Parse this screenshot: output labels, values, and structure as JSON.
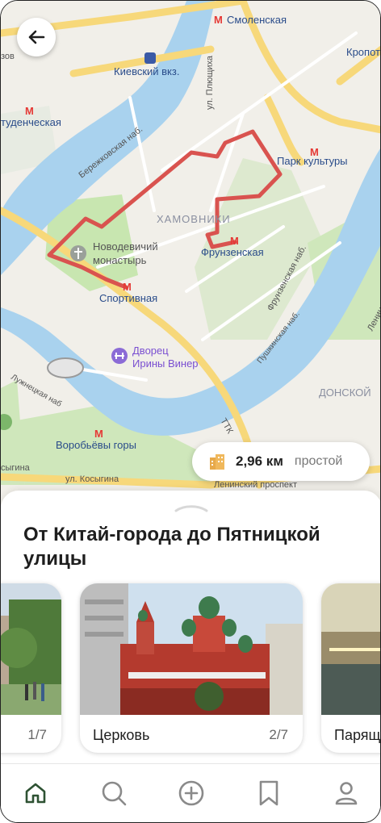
{
  "map": {
    "labels": {
      "smolenskaya": "Смоленская",
      "kropotkinskaya": "Кропот",
      "kievsky": "Киевский вкз.",
      "studencheskaya": "туденческая",
      "ul_pliushchikha": "ул. Плющиха",
      "berezhkovskaya": "Бережковская наб.",
      "park_kultury": "Парк культуры",
      "khamovniki": "ХАМОВНИКИ",
      "novodevichy": "Новодевичий монастырь",
      "novodevichy_line1": "Новодевичий",
      "novodevichy_line2": "монастырь",
      "frunzenskaya": "Фрунзенская",
      "sportivnaya": "Спортивная",
      "frunzenskaya_nab": "Фрунзенская наб.",
      "leninsky": "Ленинский",
      "dvorets_line1": "Дворец",
      "dvorets_line2": "Ирины Винер",
      "pushkinskaya_nab": "Пушкинская наб.",
      "luzhnetskaya_nab": "Лужнецкая наб",
      "donskoy": "ДОНСКОЙ",
      "ttk": "ТТК",
      "vorobyovy_gory": "Воробьёвы горы",
      "ul_kosygina": "ул. Косыгина",
      "kosygina_left": "сыгина",
      "leninsky_prospekt": "Ленинский проспект",
      "zov": "зов"
    }
  },
  "route": {
    "distance": "2,96 км",
    "difficulty": "простой"
  },
  "sheet": {
    "title": "От Китай-города до Пятницкой улицы",
    "cards": [
      {
        "name": "",
        "count": "1/7"
      },
      {
        "name": "Церковь",
        "count": "2/7"
      },
      {
        "name": "Парящ",
        "count": ""
      }
    ]
  },
  "icons": {
    "back": "arrow-left-icon",
    "building": "building-icon",
    "home": "home-icon",
    "search": "search-icon",
    "add": "plus-circle-icon",
    "bookmark": "bookmark-icon",
    "profile": "user-icon"
  },
  "colors": {
    "route": "#d9534f",
    "river": "#a9d2ee",
    "park": "#c8e6b0",
    "metro": "#e53935",
    "tab_active": "#2e5233",
    "tab_inactive": "#8a8a8a"
  }
}
